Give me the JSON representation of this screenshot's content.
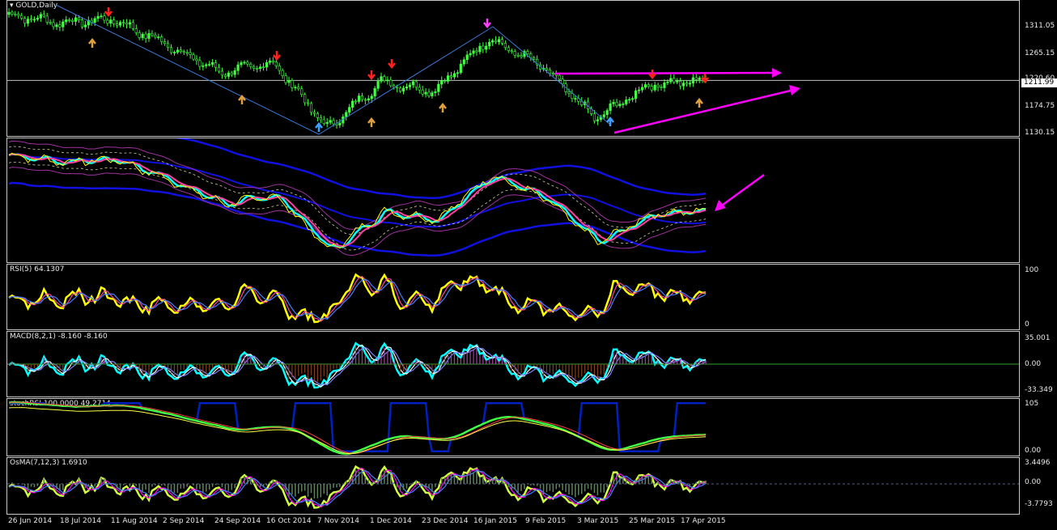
{
  "chart_data": {
    "type": "line",
    "title": "GOLD,Daily",
    "symbol": "GOLD",
    "timeframe": "Daily",
    "current_price": "1211.99",
    "x_labels": [
      "26 Jun 2014",
      "18 Jul 2014",
      "11 Aug 2014",
      "2 Sep 2014",
      "24 Sep 2014",
      "16 Oct 2014",
      "7 Nov 2014",
      "1 Dec 2014",
      "23 Dec 2014",
      "16 Jan 2015",
      "9 Feb 2015",
      "3 Mar 2015",
      "25 Mar 2015",
      "17 Apr 2015"
    ],
    "price_axis": [
      "1311.05",
      "1265.15",
      "1220.60",
      "1174.75",
      "1130.15"
    ],
    "price_series": {
      "name": "GOLD",
      "x": [
        "26 Jun 2014",
        "18 Jul 2014",
        "11 Aug 2014",
        "2 Sep 2014",
        "24 Sep 2014",
        "16 Oct 2014",
        "7 Nov 2014",
        "1 Dec 2014",
        "23 Dec 2014",
        "16 Jan 2015",
        "9 Feb 2015",
        "3 Mar 2015",
        "25 Mar 2015",
        "17 Apr 2015"
      ],
      "y": [
        1318,
        1305,
        1310,
        1270,
        1225,
        1240,
        1135,
        1210,
        1195,
        1280,
        1235,
        1150,
        1205,
        1212
      ]
    },
    "indicators": [
      {
        "name": "RSI(5)",
        "value": "64.1307",
        "axis": [
          "100",
          "0"
        ]
      },
      {
        "name": "MACD(8,2,1)",
        "value": "-8.160 -8.160",
        "axis": [
          "35.001",
          "0.00",
          "-33.349"
        ]
      },
      {
        "name": "stochRSI",
        "value": "100.0000 49.2714",
        "axis": [
          "105",
          "0.00"
        ]
      },
      {
        "name": "OsMA(7,12,3)",
        "value": "1.6910",
        "axis": [
          "3.4496",
          "0.00",
          "-3.7793"
        ]
      }
    ],
    "colors": {
      "candles": "#40ff40",
      "trendline": "#3a78d8",
      "annotation": "#ff00ff",
      "bands": "#1010e0",
      "rsi": "#ffff00",
      "macd": "#00ffff",
      "signal": "#ff40a0",
      "stoch_k": "#0020c0",
      "stoch_d": "#40ff40"
    }
  }
}
